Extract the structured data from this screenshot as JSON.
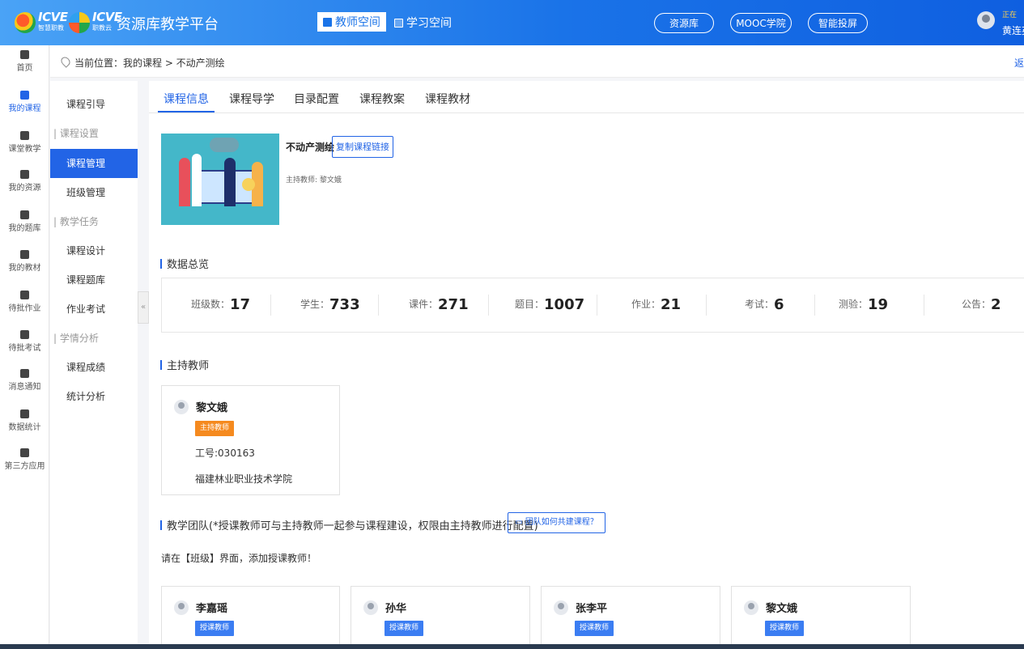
{
  "header": {
    "logo1_text": "ICVE",
    "logo1_sub": "智慧职教",
    "logo2_text": "ICVE",
    "logo2_sub": "职教云",
    "platform_title": "资源库教学平台",
    "tab_teacher": "教师空间",
    "tab_sep": "|",
    "tab_learn": "学习空间",
    "pill_resource": "资源库",
    "pill_mooc": "MOOC学院",
    "pill_smart": "智能投屏",
    "user_status": "正在",
    "user_name": "黄连英"
  },
  "leftnav": {
    "items": [
      {
        "label": "首页"
      },
      {
        "label": "我的课程"
      },
      {
        "label": "课堂教学"
      },
      {
        "label": "我的资源"
      },
      {
        "label": "我的题库"
      },
      {
        "label": "我的教材"
      },
      {
        "label": "待批作业"
      },
      {
        "label": "待批考试"
      },
      {
        "label": "消息通知"
      },
      {
        "label": "数据统计"
      },
      {
        "label": "第三方应用"
      }
    ]
  },
  "breadcrumb": {
    "text": "当前位置：我的课程 > 不动产测绘",
    "back": "返"
  },
  "subnav": {
    "items": [
      {
        "label": "课程引导"
      },
      {
        "label": "课程设置"
      },
      {
        "label": "课程管理"
      },
      {
        "label": "班级管理"
      },
      {
        "label": "教学任务"
      },
      {
        "label": "课程设计"
      },
      {
        "label": "课程题库"
      },
      {
        "label": "作业考试"
      },
      {
        "label": "学情分析"
      },
      {
        "label": "课程成绩"
      },
      {
        "label": "统计分析"
      }
    ]
  },
  "tabs": [
    "课程信息",
    "课程导学",
    "目录配置",
    "课程教案",
    "课程教材"
  ],
  "course": {
    "name": "不动产测绘",
    "copy_button": "复制课程链接",
    "host_line": "主持教师: 黎文娥"
  },
  "stats_title": "数据总览",
  "stats": [
    {
      "label": "班级数：",
      "value": "17"
    },
    {
      "label": "学生：",
      "value": "733"
    },
    {
      "label": "课件：",
      "value": "271"
    },
    {
      "label": "题目：",
      "value": "1007"
    },
    {
      "label": "作业：",
      "value": "21"
    },
    {
      "label": "考试：",
      "value": "6"
    },
    {
      "label": "测验：",
      "value": "19"
    },
    {
      "label": "公告：",
      "value": "2"
    }
  ],
  "host": {
    "title": "主持教师",
    "name": "黎文娥",
    "role": "主持教师",
    "id_line": "工号:030163",
    "school": "福建林业职业技术学院"
  },
  "team": {
    "title": "教学团队(*授课教师可与主持教师一起参与课程建设，权限由主持教师进行配置)",
    "help_button": "团队如何共建课程？",
    "note": "请在【班级】界面，添加授课教师！",
    "members": [
      {
        "name": "李嘉瑶",
        "role": "授课教师"
      },
      {
        "name": "孙华",
        "role": "授课教师"
      },
      {
        "name": "张李平",
        "role": "授课教师"
      },
      {
        "name": "黎文娥",
        "role": "授课教师"
      }
    ]
  },
  "colors": {
    "accent": "#2264e6",
    "host_badge": "#f58a1f",
    "teacher_badge": "#3b7df2"
  }
}
